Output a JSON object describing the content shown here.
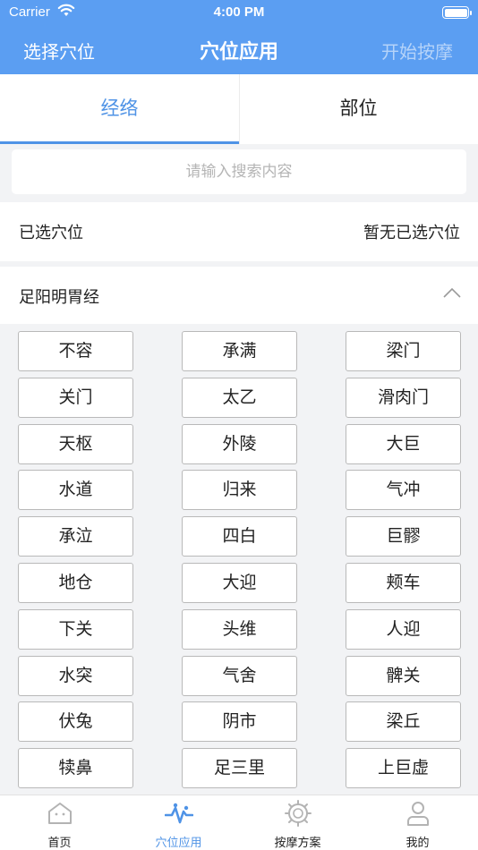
{
  "status": {
    "carrier": "Carrier",
    "time": "4:00 PM"
  },
  "nav": {
    "left": "选择穴位",
    "title": "穴位应用",
    "right": "开始按摩"
  },
  "tabs": {
    "meridian": "经络",
    "region": "部位"
  },
  "search": {
    "placeholder": "请输入搜索内容"
  },
  "selected": {
    "label": "已选穴位",
    "value": "暂无已选穴位"
  },
  "group": {
    "title": "足阳明胃经"
  },
  "points": [
    "不容",
    "承满",
    "梁门",
    "关门",
    "太乙",
    "滑肉门",
    "天枢",
    "外陵",
    "大巨",
    "水道",
    "归来",
    "气冲",
    "承泣",
    "四白",
    "巨髎",
    "地仓",
    "大迎",
    "颊车",
    "下关",
    "头维",
    "人迎",
    "水突",
    "气舍",
    "髀关",
    "伏兔",
    "阴市",
    "梁丘",
    "犊鼻",
    "足三里",
    "上巨虚"
  ],
  "tabbar": {
    "home": "首页",
    "acupoint": "穴位应用",
    "massage": "按摩方案",
    "mine": "我的"
  },
  "colors": {
    "primary": "#5b9ef2",
    "accent": "#4f93e6",
    "icon_gray": "#b3b3b3"
  }
}
